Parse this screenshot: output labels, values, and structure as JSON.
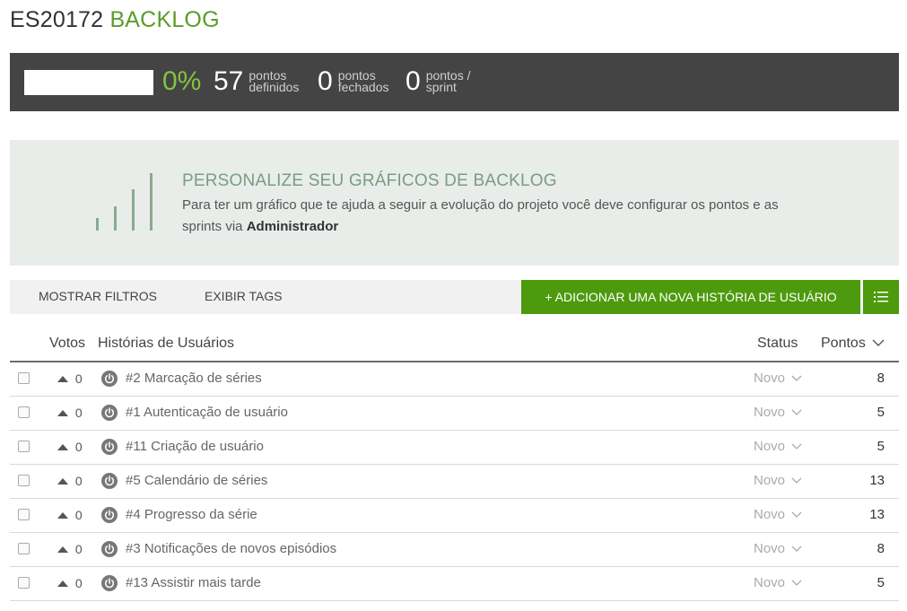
{
  "header": {
    "project": "ES20172",
    "section": "BACKLOG"
  },
  "stats": {
    "progress": 0,
    "percent_label": "0%",
    "defined_points": "57",
    "defined_label": "pontos definidos",
    "closed_points": "0",
    "closed_label": "pontos fechados",
    "sprint_points": "0",
    "sprint_label": "pontos / sprint"
  },
  "promo": {
    "title": "PERSONALIZE SEU GRÁFICOS DE BACKLOG",
    "text": "Para ter um gráfico que te ajuda a seguir a evolução do projeto você deve configurar os pontos e as sprints via",
    "link": "Administrador"
  },
  "toolbar": {
    "show_filters": "MOSTRAR FILTROS",
    "show_tags": "EXIBIR TAGS",
    "add_story": "+ ADICIONAR UMA NOVA HISTÓRIA DE USUÁRIO",
    "list_icon": "list-icon"
  },
  "table": {
    "col_votes": "Votos",
    "col_stories": "Histórias de Usuários",
    "col_status": "Status",
    "col_points": "Pontos",
    "rows": [
      {
        "votes": "0",
        "story": "#2 Marcação de séries",
        "status": "Novo",
        "points": "8"
      },
      {
        "votes": "0",
        "story": "#1 Autenticação de usuário",
        "status": "Novo",
        "points": "5"
      },
      {
        "votes": "0",
        "story": "#11 Criação de usuário",
        "status": "Novo",
        "points": "5"
      },
      {
        "votes": "0",
        "story": "#5 Calendário de séries",
        "status": "Novo",
        "points": "13"
      },
      {
        "votes": "0",
        "story": "#4 Progresso da série",
        "status": "Novo",
        "points": "13"
      },
      {
        "votes": "0",
        "story": "#3 Notificações de novos episódios",
        "status": "Novo",
        "points": "8"
      },
      {
        "votes": "0",
        "story": "#13 Assistir mais tarde",
        "status": "Novo",
        "points": "5"
      }
    ]
  },
  "colors": {
    "accent": "#4e9a0e",
    "green_text": "#83c340",
    "stats_bg": "#444444"
  }
}
